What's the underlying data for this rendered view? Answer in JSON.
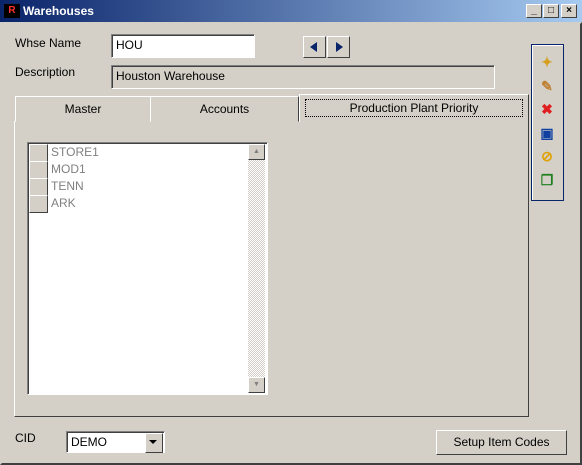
{
  "window": {
    "title": "Warehouses",
    "icon_glyph": "R",
    "minimize_glyph": "_",
    "maximize_glyph": "□",
    "close_glyph": "×"
  },
  "form": {
    "whse_name_label": "Whse Name",
    "whse_name_value": "HOU",
    "description_label": "Description",
    "description_value": "Houston Warehouse"
  },
  "nav": {
    "prev_icon": "left-arrow-icon",
    "next_icon": "right-arrow-icon"
  },
  "toolbar": {
    "items": [
      {
        "name": "new-icon",
        "glyph": "✦",
        "color": "#d4a020"
      },
      {
        "name": "edit-icon",
        "glyph": "✎",
        "color": "#c08030"
      },
      {
        "name": "delete-icon",
        "glyph": "✖",
        "color": "#e02020"
      },
      {
        "name": "save-icon",
        "glyph": "▣",
        "color": "#1040a0"
      },
      {
        "name": "cancel-icon",
        "glyph": "⊘",
        "color": "#e0a000"
      },
      {
        "name": "copy-icon",
        "glyph": "❐",
        "color": "#208020"
      }
    ]
  },
  "tabs": [
    {
      "label": "Master",
      "active": false
    },
    {
      "label": "Accounts",
      "active": false
    },
    {
      "label": "Production Plant Priority",
      "active": true
    }
  ],
  "priority_list": {
    "items": [
      {
        "label": "STORE1",
        "checked": false
      },
      {
        "label": "MOD1",
        "checked": false
      },
      {
        "label": "TENN",
        "checked": false
      },
      {
        "label": "ARK",
        "checked": false
      }
    ],
    "scroll_up_glyph": "▲",
    "scroll_down_glyph": "▼"
  },
  "bottom": {
    "cid_label": "CID",
    "cid_value": "DEMO",
    "setup_button_label": "Setup Item Codes"
  }
}
